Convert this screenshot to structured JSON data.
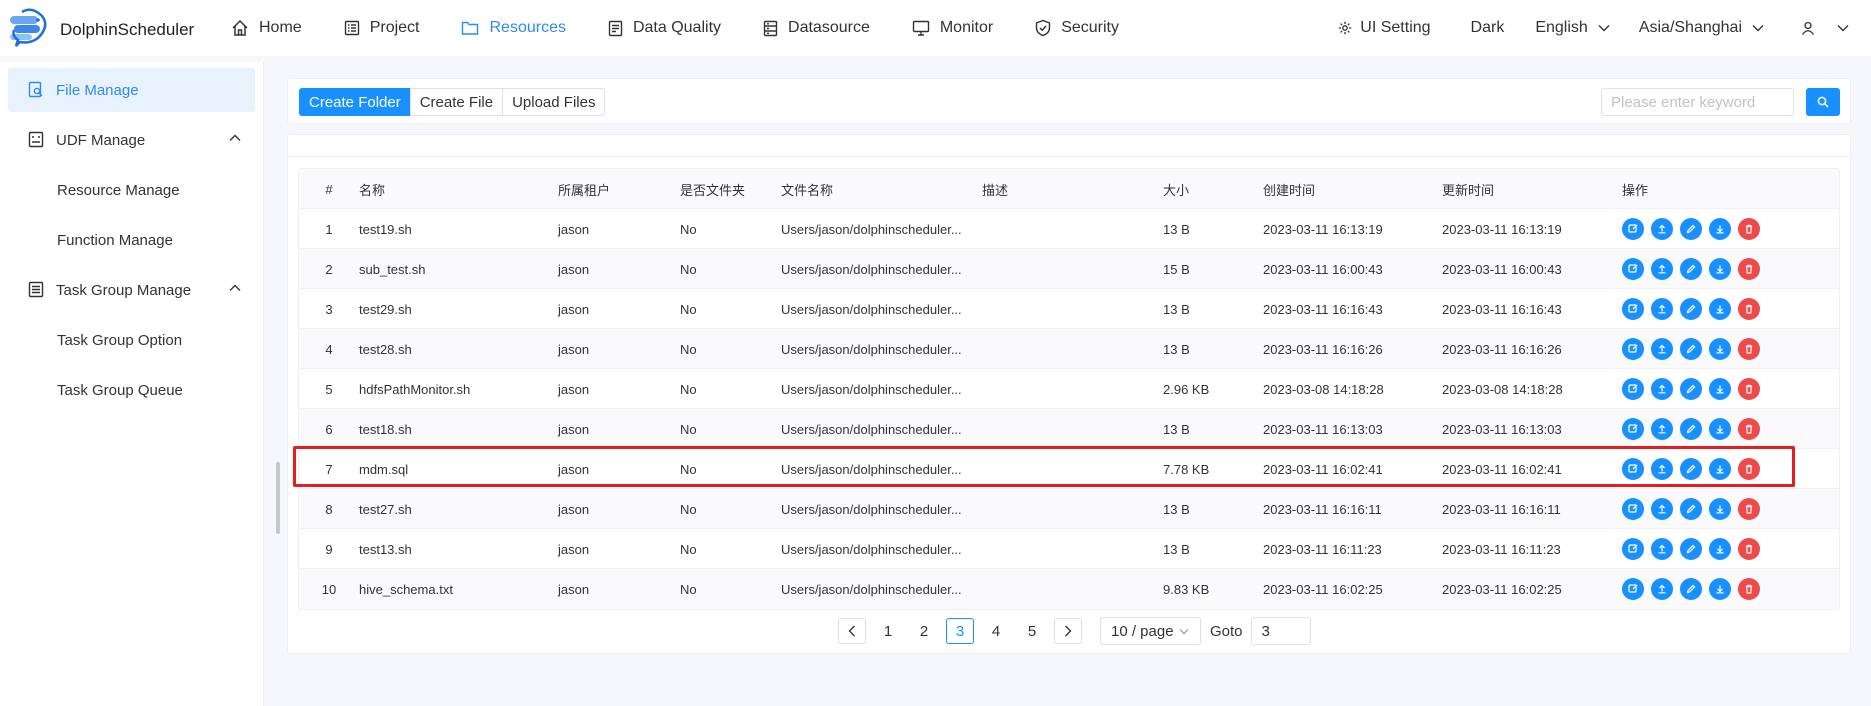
{
  "app": {
    "name": "DolphinScheduler"
  },
  "nav": [
    {
      "label": "Home",
      "icon": "home-icon"
    },
    {
      "label": "Project",
      "icon": "project-icon"
    },
    {
      "label": "Resources",
      "icon": "folder-icon",
      "active": true
    },
    {
      "label": "Data Quality",
      "icon": "data-quality-icon"
    },
    {
      "label": "Datasource",
      "icon": "datasource-icon"
    },
    {
      "label": "Monitor",
      "icon": "monitor-icon"
    },
    {
      "label": "Security",
      "icon": "shield-icon"
    }
  ],
  "right_nav": {
    "ui_setting": "UI Setting",
    "theme": "Dark",
    "language": "English",
    "timezone": "Asia/Shanghai"
  },
  "sidebar": {
    "items": [
      {
        "label": "File Manage"
      },
      {
        "label": "UDF Manage"
      },
      {
        "label": "Resource Manage"
      },
      {
        "label": "Function Manage"
      },
      {
        "label": "Task Group Manage"
      },
      {
        "label": "Task Group Option"
      },
      {
        "label": "Task Group Queue"
      }
    ]
  },
  "toolbar": {
    "create_folder": "Create Folder",
    "create_file": "Create File",
    "upload_files": "Upload Files",
    "search_placeholder": "Please enter keyword"
  },
  "table": {
    "columns": [
      "#",
      "名称",
      "所属租户",
      "是否文件夹",
      "文件名称",
      "描述",
      "大小",
      "创建时间",
      "更新时间",
      "操作"
    ],
    "rows": [
      {
        "num": "1",
        "name": "test19.sh",
        "tenant": "jason",
        "is_dir": "No",
        "file_name": "Users/jason/dolphinscheduler...",
        "desc": "",
        "size": "13 B",
        "created": "2023-03-11 16:13:19",
        "updated": "2023-03-11 16:13:19"
      },
      {
        "num": "2",
        "name": "sub_test.sh",
        "tenant": "jason",
        "is_dir": "No",
        "file_name": "Users/jason/dolphinscheduler...",
        "desc": "",
        "size": "15 B",
        "created": "2023-03-11 16:00:43",
        "updated": "2023-03-11 16:00:43"
      },
      {
        "num": "3",
        "name": "test29.sh",
        "tenant": "jason",
        "is_dir": "No",
        "file_name": "Users/jason/dolphinscheduler...",
        "desc": "",
        "size": "13 B",
        "created": "2023-03-11 16:16:43",
        "updated": "2023-03-11 16:16:43"
      },
      {
        "num": "4",
        "name": "test28.sh",
        "tenant": "jason",
        "is_dir": "No",
        "file_name": "Users/jason/dolphinscheduler...",
        "desc": "",
        "size": "13 B",
        "created": "2023-03-11 16:16:26",
        "updated": "2023-03-11 16:16:26"
      },
      {
        "num": "5",
        "name": "hdfsPathMonitor.sh",
        "tenant": "jason",
        "is_dir": "No",
        "file_name": "Users/jason/dolphinscheduler...",
        "desc": "",
        "size": "2.96 KB",
        "created": "2023-03-08 14:18:28",
        "updated": "2023-03-08 14:18:28"
      },
      {
        "num": "6",
        "name": "test18.sh",
        "tenant": "jason",
        "is_dir": "No",
        "file_name": "Users/jason/dolphinscheduler...",
        "desc": "",
        "size": "13 B",
        "created": "2023-03-11 16:13:03",
        "updated": "2023-03-11 16:13:03"
      },
      {
        "num": "7",
        "name": "mdm.sql",
        "tenant": "jason",
        "is_dir": "No",
        "file_name": "Users/jason/dolphinscheduler...",
        "desc": "",
        "size": "7.78 KB",
        "created": "2023-03-11 16:02:41",
        "updated": "2023-03-11 16:02:41"
      },
      {
        "num": "8",
        "name": "test27.sh",
        "tenant": "jason",
        "is_dir": "No",
        "file_name": "Users/jason/dolphinscheduler...",
        "desc": "",
        "size": "13 B",
        "created": "2023-03-11 16:16:11",
        "updated": "2023-03-11 16:16:11"
      },
      {
        "num": "9",
        "name": "test13.sh",
        "tenant": "jason",
        "is_dir": "No",
        "file_name": "Users/jason/dolphinscheduler...",
        "desc": "",
        "size": "13 B",
        "created": "2023-03-11 16:11:23",
        "updated": "2023-03-11 16:11:23"
      },
      {
        "num": "10",
        "name": "hive_schema.txt",
        "tenant": "jason",
        "is_dir": "No",
        "file_name": "Users/jason/dolphinscheduler...",
        "desc": "",
        "size": "9.83 KB",
        "created": "2023-03-11 16:02:25",
        "updated": "2023-03-11 16:02:25"
      }
    ]
  },
  "pagination": {
    "pages": [
      "1",
      "2",
      "3",
      "4",
      "5"
    ],
    "current": "3",
    "page_size": "10 / page",
    "goto_label": "Goto",
    "goto_value": "3"
  },
  "colors": {
    "accent": "#1890ff",
    "danger": "#ee4a4a",
    "highlight": "#e41e1e"
  }
}
